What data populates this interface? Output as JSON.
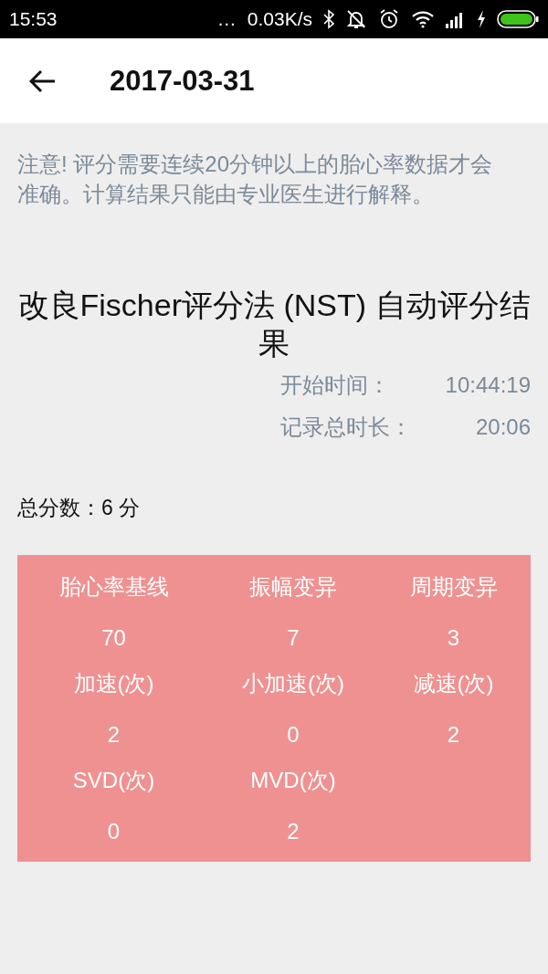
{
  "status_bar": {
    "time": "15:53",
    "more": "…",
    "net_speed": "0.03K/s"
  },
  "app_bar": {
    "title": "2017-03-31"
  },
  "notice": "注意! 评分需要连续20分钟以上的胎心率数据才会准确。计算结果只能由专业医生进行解释。",
  "result": {
    "title": "改良Fischer评分法 (NST) 自动评分结果",
    "info": [
      {
        "label": "开始时间：",
        "value": "10:44:19"
      },
      {
        "label": "记录总时长：",
        "value": "20:06"
      }
    ],
    "total": "总分数：6 分"
  },
  "scores": [
    {
      "label": "胎心率基线",
      "value": "70"
    },
    {
      "label": "振幅变异",
      "value": "7"
    },
    {
      "label": "周期变异",
      "value": "3"
    },
    {
      "label": "加速(次)",
      "value": "2"
    },
    {
      "label": "小加速(次)",
      "value": "0"
    },
    {
      "label": "减速(次)",
      "value": "2"
    },
    {
      "label": "SVD(次)",
      "value": "0"
    },
    {
      "label": "MVD(次)",
      "value": "2"
    }
  ]
}
